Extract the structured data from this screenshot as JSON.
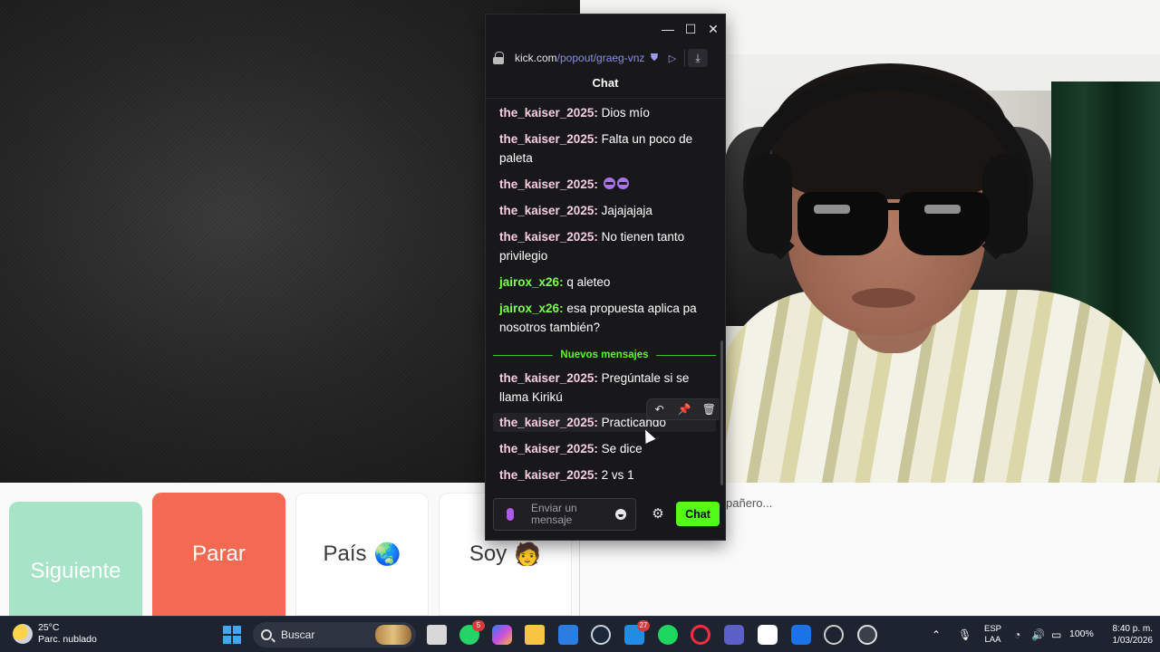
{
  "chat_window": {
    "controls": {
      "minimize": "—",
      "maximize": "☐",
      "close": "✕"
    },
    "url_domain": "kick.com",
    "url_path": "/popout/graeg-vnz",
    "title": "Chat",
    "messages": [
      {
        "user": "the_kaiser_2025",
        "colon": ": ",
        "text": "Dios mío",
        "color": "#f7cde3"
      },
      {
        "user": "the_kaiser_2025",
        "colon": ": ",
        "text": "Falta un poco de paleta",
        "color": "#f7cde3"
      },
      {
        "user": "the_kaiser_2025",
        "colon": ": ",
        "text": "",
        "color": "#f7cde3",
        "emotes": 2
      },
      {
        "user": "the_kaiser_2025",
        "colon": ": ",
        "text": "Jajajajaja",
        "color": "#f7cde3"
      },
      {
        "user": "the_kaiser_2025",
        "colon": ": ",
        "text": "No tienen tanto privilegio",
        "color": "#f7cde3"
      },
      {
        "user": "jairox_x26",
        "colon": ": ",
        "text": "q aleteo",
        "color": "#7cff4f"
      },
      {
        "user": "jairox_x26",
        "colon": ": ",
        "text": "esa propuesta aplica pa nosotros también?",
        "color": "#7cff4f"
      },
      {
        "user": "the_kaiser_2025",
        "colon": ": ",
        "text": "Pregúntale si se llama Kirikú",
        "color": "#f7cde3"
      },
      {
        "user": "the_kaiser_2025",
        "colon": ": ",
        "text": "Practicando",
        "color": "#f7cde3"
      },
      {
        "user": "the_kaiser_2025",
        "colon": ": ",
        "text": "Se dice",
        "color": "#f7cde3"
      },
      {
        "user": "the_kaiser_2025",
        "colon": ": ",
        "text": "2 vs 1",
        "color": "#f7cde3"
      }
    ],
    "new_messages_label": "Nuevos mensajes",
    "input_placeholder": "Enviar un mensaje",
    "send_label": "Chat",
    "accent": "#53fc18"
  },
  "app": {
    "next_label": "Siguiente",
    "stop_label": "Parar",
    "country_label": "País",
    "country_emoji": "🌏",
    "me_label": "Soy",
    "me_emoji": "🧑",
    "partner_typing": "pañero..."
  },
  "taskbar": {
    "temperature": "25°C",
    "weather": "Parc. nublado",
    "search_label": "Buscar",
    "whatsapp_badge": "5",
    "store_badge": "27",
    "lang_line1": "ESP",
    "lang_line2": "LAA",
    "battery": "100%",
    "time": "8:40 p. m.",
    "date": "1/03/2026"
  }
}
